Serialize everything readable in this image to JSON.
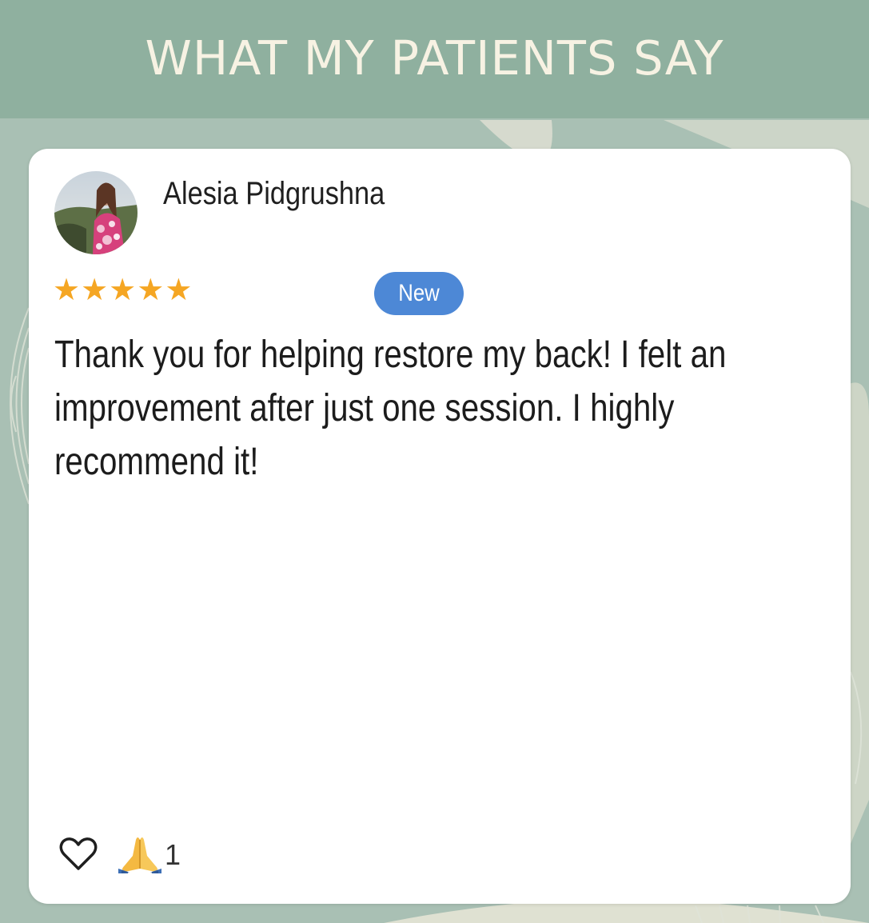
{
  "header": {
    "title": "WHAT MY PATIENTS SAY"
  },
  "review": {
    "reviewer_name": "Alesia Pidgrushna",
    "rating": 5,
    "stars": [
      "★",
      "★",
      "★",
      "★",
      "★"
    ],
    "badge": "New",
    "text": "Thank you for helping restore my back! I felt an improvement after just one session. I highly recommend it!",
    "reaction_count": "1"
  },
  "icons": {
    "avatar": "reviewer-photo",
    "like": "heart-outline-icon",
    "reaction": "praying-hands-icon"
  },
  "colors": {
    "background": "#a9c0b4",
    "header": "#8fb09f",
    "header_text": "#f7f2e3",
    "card": "#ffffff",
    "star": "#f5a623",
    "badge": "#4d88d6"
  }
}
